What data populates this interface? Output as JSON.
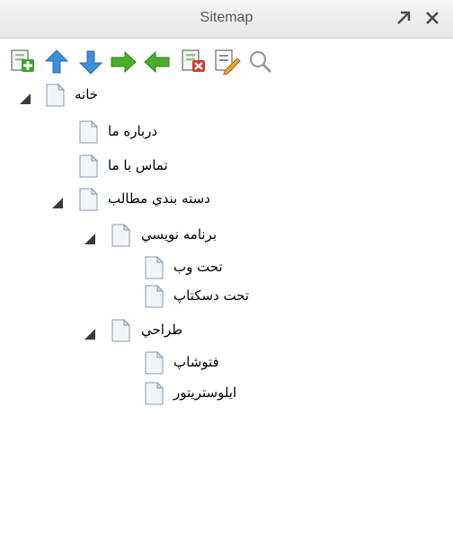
{
  "panel": {
    "title": "Sitemap"
  },
  "toolbar": {
    "buttons": [
      {
        "icon": "add-page-icon"
      },
      {
        "icon": "arrow-up-icon"
      },
      {
        "icon": "arrow-down-icon"
      },
      {
        "icon": "arrow-right-icon"
      },
      {
        "icon": "arrow-left-icon"
      },
      {
        "icon": "delete-page-icon"
      },
      {
        "icon": "edit-page-icon"
      },
      {
        "icon": "search-icon"
      }
    ]
  },
  "colors": {
    "accent_green": "#3f9f2c",
    "accent_blue": "#3f8fd8",
    "accent_red": "#d23a2a",
    "toggle_dark": "#3a3a3a"
  },
  "tree": [
    {
      "label": "خانه",
      "expanded": true
    },
    {
      "label": "درباره ما"
    },
    {
      "label": "تماس با ما"
    },
    {
      "label": "دسته بندي مطالب",
      "expanded": true
    },
    {
      "label": "برنامه نويسي",
      "expanded": true
    },
    {
      "label": "تحت وب"
    },
    {
      "label": "تحت دسکتاپ"
    },
    {
      "label": "طراحي",
      "expanded": true
    },
    {
      "label": "فتوشاپ"
    },
    {
      "label": "ايلوستريتور"
    }
  ]
}
